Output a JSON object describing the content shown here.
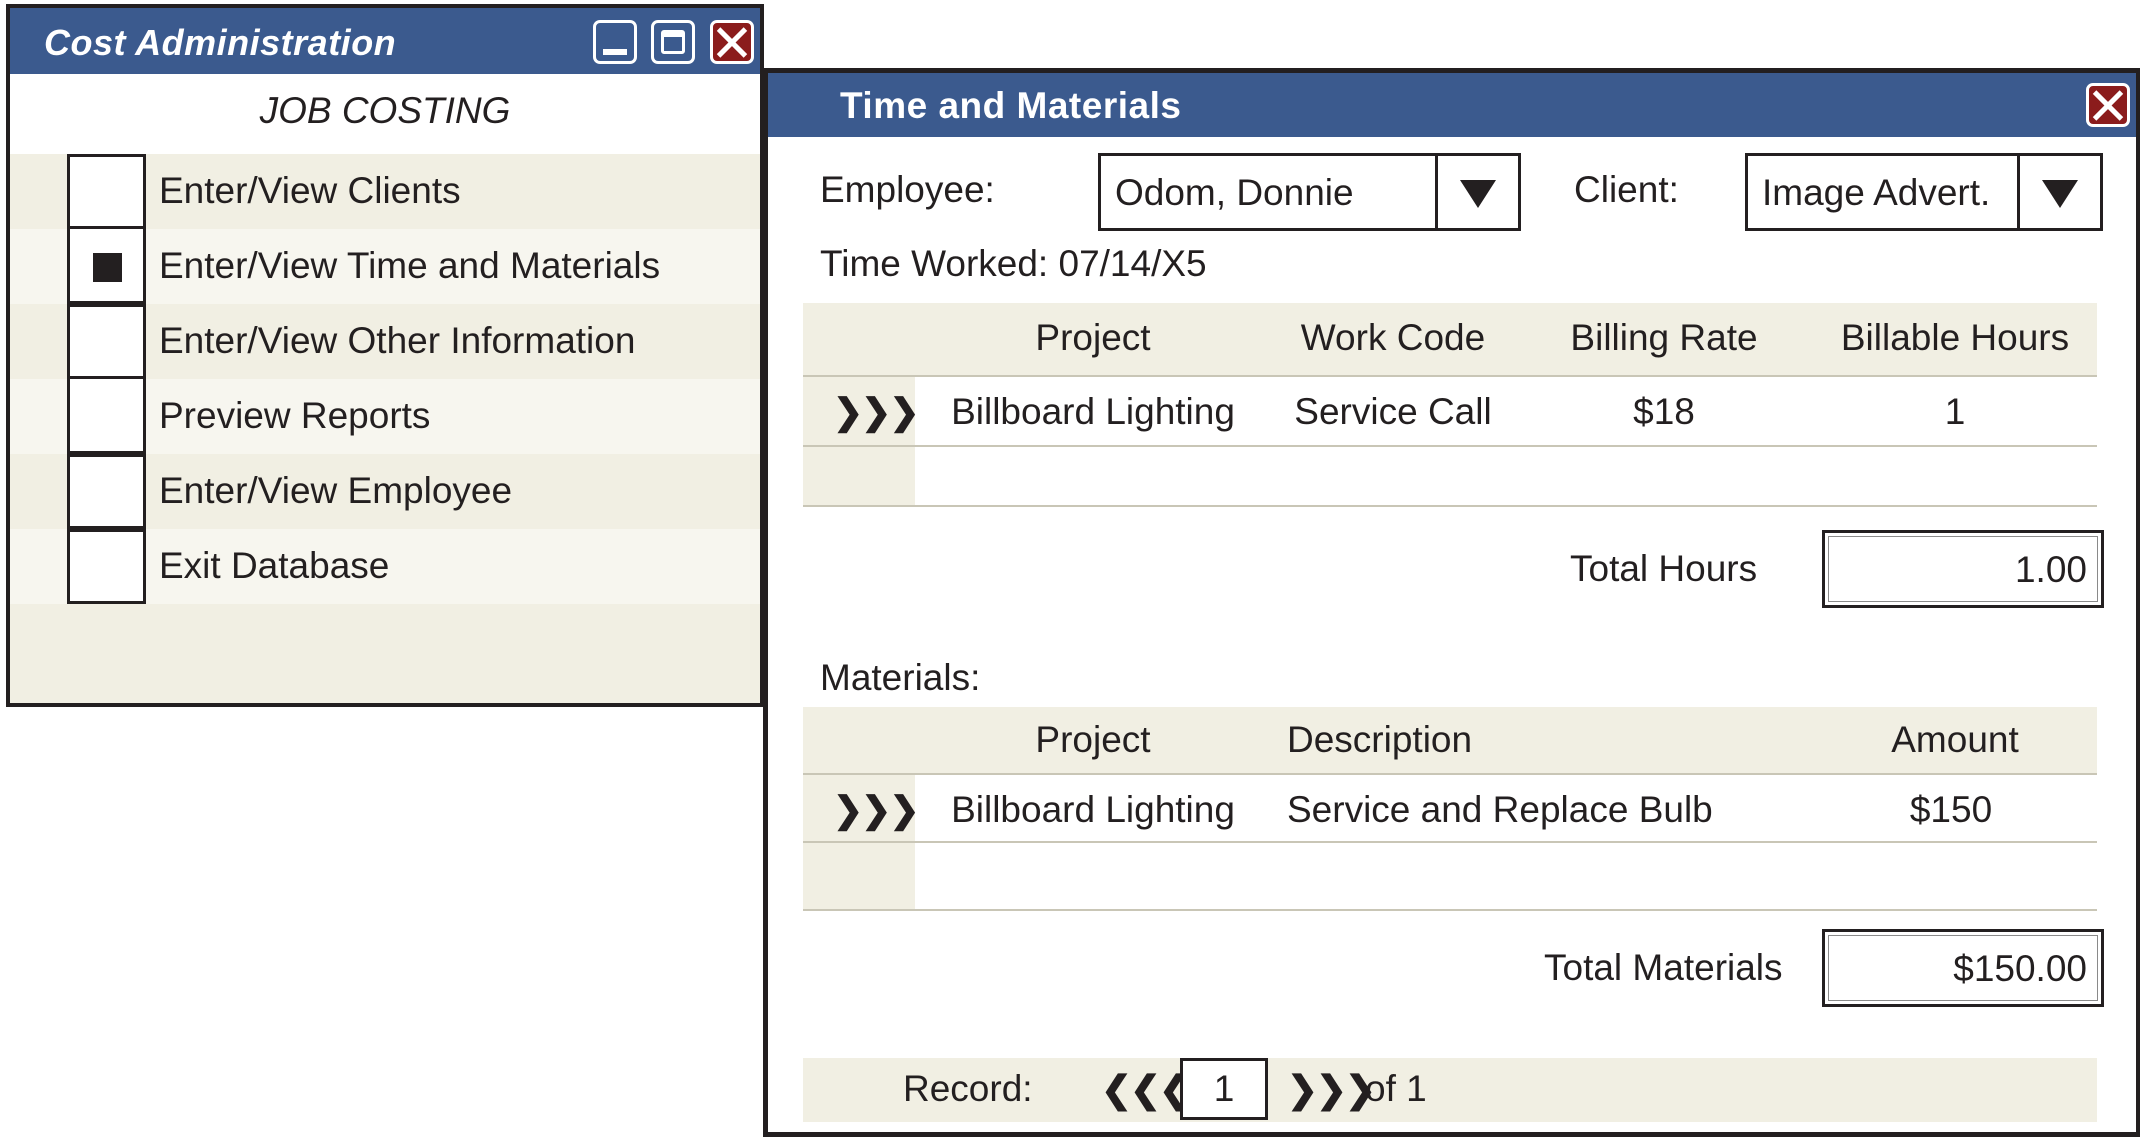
{
  "cost_admin": {
    "title": "Cost Administration",
    "heading": "JOB COSTING",
    "menu": [
      {
        "label": "Enter/View Clients",
        "checked": false
      },
      {
        "label": "Enter/View Time and Materials",
        "checked": true
      },
      {
        "label": "Enter/View Other Information",
        "checked": false
      },
      {
        "label": "Preview Reports",
        "checked": false
      },
      {
        "label": "Enter/View Employee",
        "checked": false
      },
      {
        "label": "Exit Database",
        "checked": false
      }
    ]
  },
  "tm": {
    "title": "Time and Materials",
    "employee_label": "Employee:",
    "employee_value": "Odom, Donnie",
    "client_label": "Client:",
    "client_value": "Image Advert.",
    "time_worked": "Time Worked: 07/14/X5",
    "time_headers": [
      "Project",
      "Work Code",
      "Billing Rate",
      "Billable Hours"
    ],
    "time_rows": [
      {
        "project": "Billboard Lighting",
        "work_code": "Service Call",
        "billing_rate": "$18",
        "billable_hours": "1"
      }
    ],
    "total_hours_label": "Total Hours",
    "total_hours_value": "1.00",
    "materials_label": "Materials:",
    "materials_headers": [
      "Project",
      "Description",
      "Amount"
    ],
    "materials_rows": [
      {
        "project": "Billboard Lighting",
        "description": "Service and Replace Bulb",
        "amount": "$150"
      }
    ],
    "total_materials_label": "Total Materials",
    "total_materials_value": "$150.00",
    "record_label": "Record:",
    "record_prev": "❮❮❮",
    "record_value": "1",
    "record_next": "❯❯❯",
    "record_of": "of 1",
    "row_selector": "❯❯❯"
  },
  "colors": {
    "titlebar": "#3b5a8e",
    "close": "#8b1c1c",
    "panel": "#f1efe3"
  }
}
